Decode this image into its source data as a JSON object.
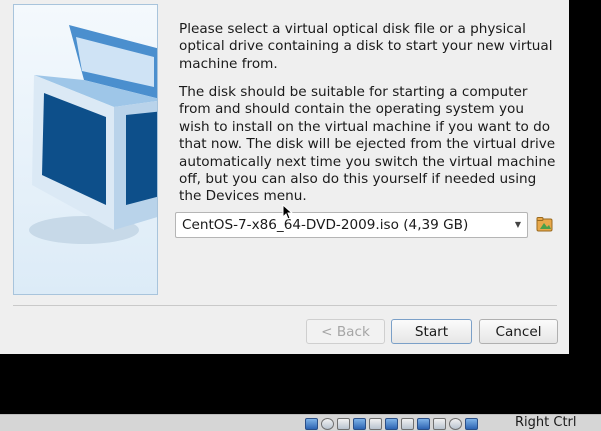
{
  "dialog": {
    "intro_text": "Please select a virtual optical disk file or a physical optical drive containing a disk to start your new virtual machine from.",
    "detail_text": "The disk should be suitable for starting a computer from and should contain the operating system you wish to install on the virtual machine if you want to do that now. The disk will be ejected from the virtual drive automatically next time you switch the virtual machine off, but you can also do this yourself if needed using the Devices menu.",
    "disk_select": {
      "selected_value": "CentOS-7-x86_64-DVD-2009.iso (4,39 GB)",
      "arrow_icon": "chevron-down-icon"
    },
    "choose_disk_icon": "folder-open-icon",
    "buttons": {
      "back_label": "< Back",
      "start_label": "Start",
      "cancel_label": "Cancel"
    }
  },
  "statusbar": {
    "host_key_label": "Right Ctrl",
    "icons": [
      "hard-disk-icon",
      "optical-disk-icon",
      "audio-icon",
      "network-icon",
      "usb-icon",
      "shared-folders-icon",
      "display-icon",
      "video-capture-icon",
      "cpu-icon",
      "mouse-integration-icon",
      "keyboard-icon"
    ]
  },
  "colors": {
    "dialog_bg": "#efefef",
    "accent": "#7ba0c8",
    "desktop_bg": "#000000"
  }
}
